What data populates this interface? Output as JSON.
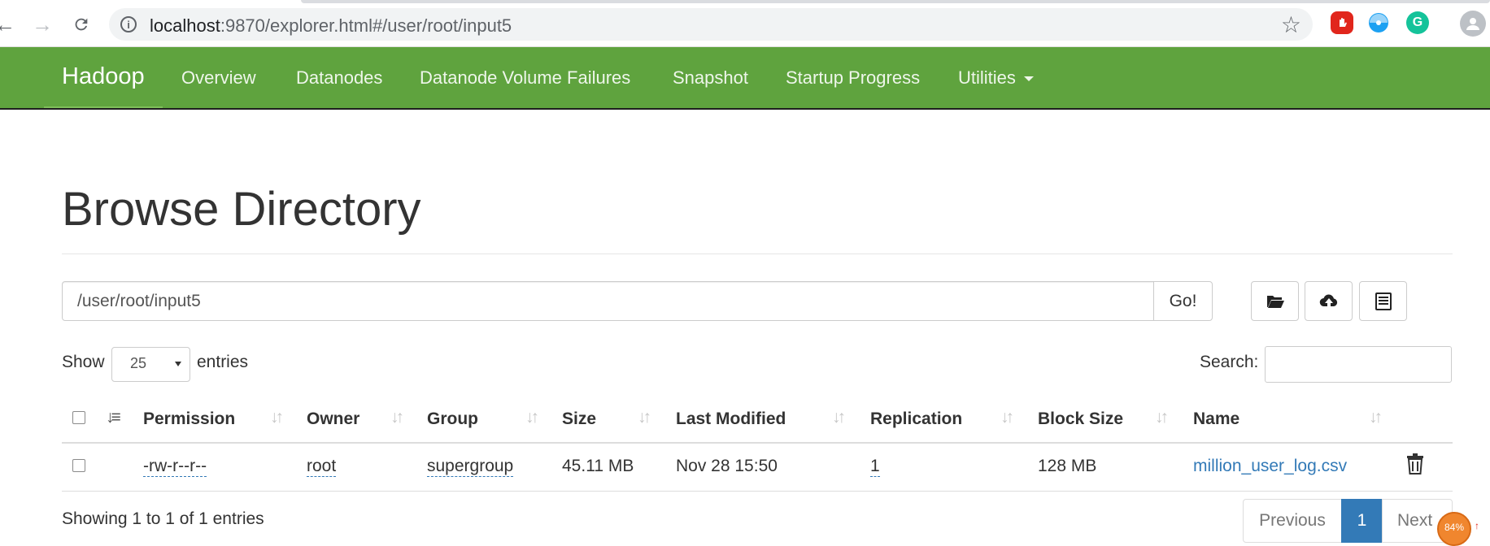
{
  "browser": {
    "url_host": "localhost",
    "url_rest": ":9870/explorer.html#/user/root/input5"
  },
  "navbar": {
    "brand": "Hadoop",
    "items": [
      "Overview",
      "Datanodes",
      "Datanode Volume Failures",
      "Snapshot",
      "Startup Progress",
      "Utilities"
    ]
  },
  "page": {
    "title": "Browse Directory",
    "path_value": "/user/root/input5",
    "go_label": "Go!"
  },
  "table_controls": {
    "show_label": "Show",
    "entries_value": "25",
    "entries_label": "entries",
    "search_label": "Search:"
  },
  "table": {
    "headers": [
      "Permission",
      "Owner",
      "Group",
      "Size",
      "Last Modified",
      "Replication",
      "Block Size",
      "Name"
    ],
    "rows": [
      {
        "permission": "-rw-r--r--",
        "owner": "root",
        "group": "supergroup",
        "size": "45.11 MB",
        "last_modified": "Nov 28 15:50",
        "replication": "1",
        "block_size": "128 MB",
        "name": "million_user_log.csv"
      }
    ]
  },
  "footer": {
    "info": "Showing 1 to 1 of 1 entries",
    "previous": "Previous",
    "current_page": "1",
    "next": "Next"
  },
  "overlay": {
    "zoom_badge": "84%",
    "zoom_arrow": "↑"
  },
  "colors": {
    "navbar": "#5fa33e",
    "link": "#337ab7",
    "page_active": "#337ab7"
  },
  "icons": [
    "back-arrow-icon",
    "forward-arrow-icon",
    "reload-icon",
    "info-icon",
    "star-icon",
    "folder-open-icon",
    "cloud-upload-icon",
    "list-icon",
    "trash-icon",
    "sort-icon"
  ]
}
